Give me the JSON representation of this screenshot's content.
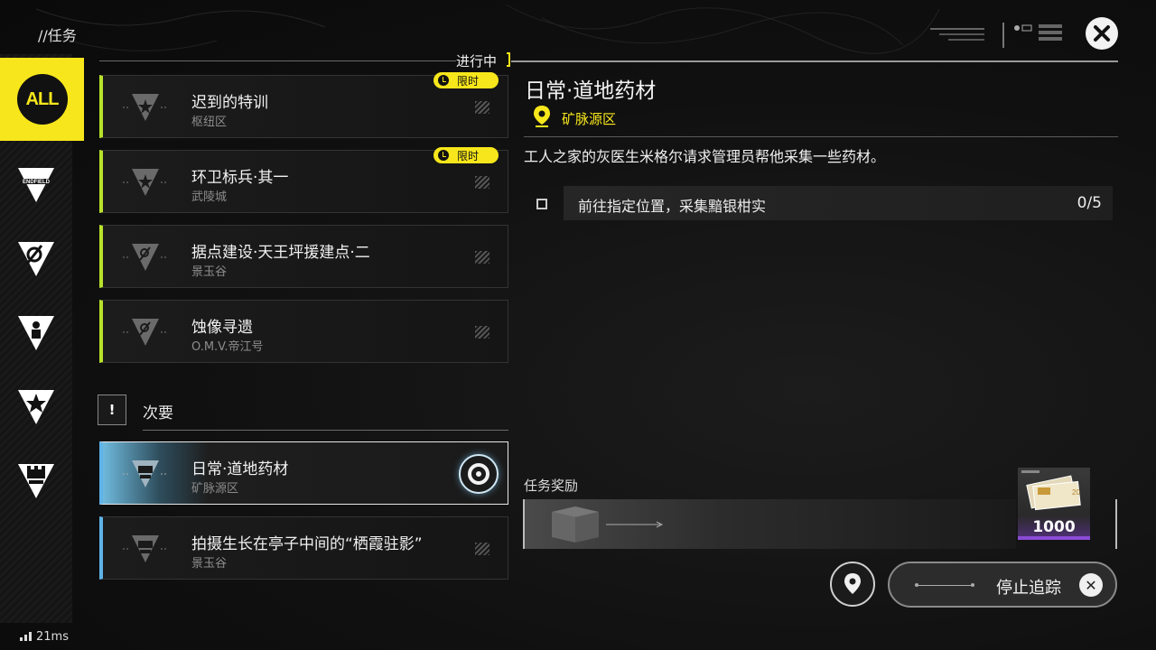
{
  "header": {
    "title": "//任务",
    "close_icon": "close-icon"
  },
  "sidebar": {
    "items": [
      {
        "label": "ALL",
        "icon": "all-icon",
        "active": true
      },
      {
        "label": "ENDFIELD",
        "icon": "endfield-icon",
        "active": false
      },
      {
        "label": "",
        "icon": "comet-icon",
        "active": false
      },
      {
        "label": "",
        "icon": "person-icon",
        "active": false
      },
      {
        "label": "",
        "icon": "star-icon",
        "active": false
      },
      {
        "label": "",
        "icon": "tower-icon",
        "active": false
      }
    ]
  },
  "list": {
    "in_progress_label": "进行中",
    "secondary_label": "次要",
    "secondary_icon_text": "!",
    "quests": [
      {
        "title": "迟到的特训",
        "sub": "枢纽区",
        "limited": true,
        "limited_label": "限时"
      },
      {
        "title": "环卫标兵·其一",
        "sub": "武陵城",
        "limited": true,
        "limited_label": "限时"
      },
      {
        "title": "据点建设·天王坪援建点·二",
        "sub": "景玉谷",
        "limited": false
      },
      {
        "title": "蚀像寻遗",
        "sub": "O.M.V.帝江号",
        "limited": false
      }
    ],
    "secondary_quests": [
      {
        "title": "日常·道地药材",
        "sub": "矿脉源区",
        "selected": true
      },
      {
        "title": "拍摄生长在亭子中间的“栖霞驻影”",
        "sub": "景玉谷",
        "selected": false
      }
    ]
  },
  "detail": {
    "title": "日常·道地药材",
    "location": "矿脉源区",
    "description": "工人之家的灰医生米格尔请求管理员帮他采集一些药材。",
    "objective": {
      "text": "前往指定位置，采集黯银柑实",
      "count": "0/5"
    },
    "reward_label": "任务奖励",
    "reward_qty": "1000",
    "stop_tracking_label": "停止追踪"
  },
  "status": {
    "ping": "21ms"
  },
  "colors": {
    "accent": "#f7e61b",
    "green": "#b9e22b",
    "blue": "#5fb3e8"
  }
}
